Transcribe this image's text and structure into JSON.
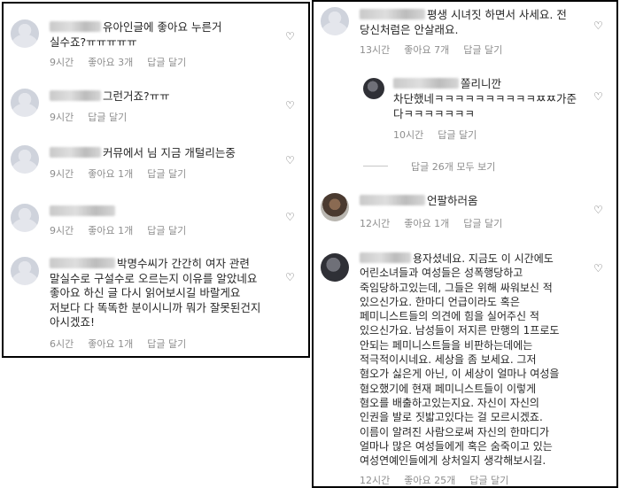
{
  "left": [
    {
      "lines": [
        "유아인글에 좋아요 누른거",
        "실수죠?ㅠㅠㅠㅠㅠ"
      ],
      "time": "9시간",
      "likes": "좋아요 3개",
      "reply": "답글 달기"
    },
    {
      "lines": [
        "그런거죠?ㅠㅠ"
      ],
      "time": "9시간",
      "likes": "",
      "reply": "답글 달기"
    },
    {
      "lines": [
        "커뮤에서 님 지금 개털리는중"
      ],
      "time": "9시간",
      "likes": "좋아요 1개",
      "reply": "답글 달기"
    },
    {
      "lines": [
        ""
      ],
      "time": "9시간",
      "likes": "좋아요 1개",
      "reply": "답글 달기"
    },
    {
      "lines": [
        "박명수씨가 간간히 여자 관련",
        "말실수로 구설수로 오르는지 이유를 알았네요",
        "좋아요 하신 글 다시 읽어보시길 바랄게요",
        "저보다 다 똑똑한 분이시니까 뭐가 잘못된건지",
        "아시겠죠!"
      ],
      "time": "6시간",
      "likes": "좋아요 1개",
      "reply": "답글 달기"
    }
  ],
  "right": {
    "top": {
      "lines": [
        "평생 시녀짓 하면서 사세요. 전",
        "당신처럼은 안살래요."
      ],
      "time": "13시간",
      "likes": "좋아요 7개",
      "reply": "답글 달기"
    },
    "reply1": {
      "lines": [
        "쫄리니깐",
        "차단했네ㅋㅋㅋㅋㅋㅋㅋㅋㅋㅋㅉㅉ가준",
        "다ㅋㅋㅋㅋㅋㅋㅋ"
      ],
      "time": "10시간",
      "reply": "답글 달기"
    },
    "more": {
      "label": "답글 26개 모두 보기"
    },
    "mid": {
      "lines": [
        "언팔하러옴"
      ],
      "time": "12시간",
      "likes": "좋아요 1개",
      "reply": "답글 달기"
    },
    "long": {
      "lines": [
        "용자셨네요. 지금도 이 시간에도",
        "어린소녀들과 여성들은 성폭행당하고",
        "죽임당하고있는데, 그들은 위해 싸워보신 적",
        "있으신가요. 한마디 언급이라도 혹은",
        "페미니스트들의 의견에 힘을 실어주신 적",
        "있으신가요. 남성들이 저지른 만행의 1프로도",
        "안되는 페미니스트들을 비판하는데에는",
        "적극적이시네요. 세상을 좀 보세요. 그저",
        "혐오가 싫은게 아닌, 이 세상이 얼마나 여성을",
        "혐오했기에 현재 페미니스트들이 이렇게",
        "혐오를 배출하고있는지요. 자신이 자신의",
        "인권을 발로 짓밟고있다는 걸 모르시겠죠.",
        "이름이 알려진 사람으로써 자신의 한마디가",
        "얼마나 많은 여성들에게 혹은 숨죽이고 있는",
        "여성연예인들에게 상처일지 생각해보시길."
      ],
      "time": "12시간",
      "likes": "좋아요 25개",
      "reply": "답글 달기"
    }
  },
  "icons": {
    "heart": "heart-outline-icon"
  }
}
